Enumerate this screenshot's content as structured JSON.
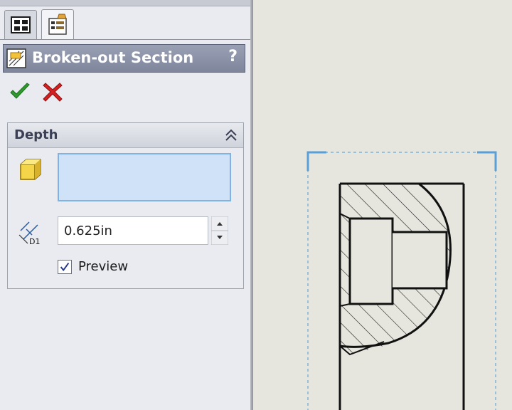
{
  "panel": {
    "title": "Broken-out Section",
    "help_label": "?",
    "tabs": [
      {
        "icon": "feature-manager-tree-icon"
      },
      {
        "icon": "property-manager-icon"
      }
    ],
    "actions": {
      "ok_icon": "check-icon",
      "cancel_icon": "cross-icon"
    },
    "group": {
      "title": "Depth",
      "depth_reference_placeholder": "",
      "depth_value": "0.625in",
      "dimension_label": "D1",
      "preview_label": "Preview",
      "preview_checked": true
    }
  },
  "colors": {
    "title_bar": "#8a90a6",
    "selection_box": "#cfe2f7",
    "ok_green": "#2e9a2e",
    "cancel_red": "#d42020",
    "canvas_background": "#e6e6de",
    "view_boundary": "#5aa0d8"
  }
}
